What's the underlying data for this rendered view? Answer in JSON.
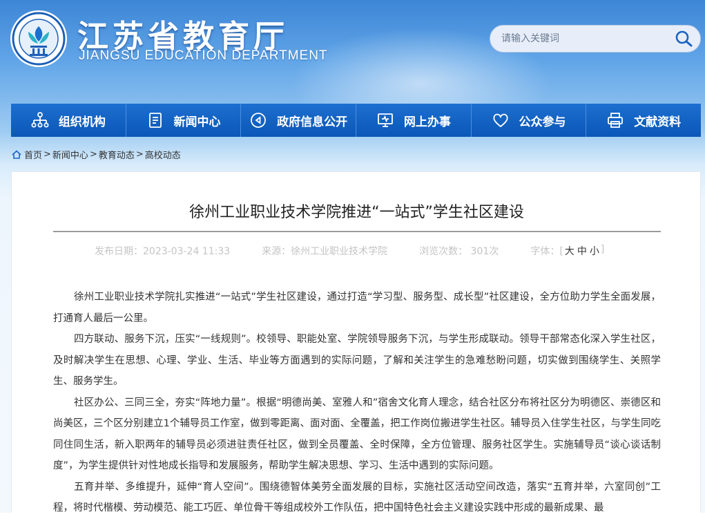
{
  "header": {
    "title_cn": "江苏省教育厅",
    "title_en": "JIANGSU EDUCATION DEPARTMENT",
    "search_placeholder": "请输入关键词",
    "logo_icon": "jiangsu-education-emblem",
    "search_icon": "magnifier"
  },
  "nav": [
    {
      "label": "组织机构",
      "icon": "org-chart-icon"
    },
    {
      "label": "新闻中心",
      "icon": "document-icon"
    },
    {
      "label": "政府信息公开",
      "icon": "play-circle-icon"
    },
    {
      "label": "网上办事",
      "icon": "monitor-icon"
    },
    {
      "label": "公众参与",
      "icon": "heart-icon"
    },
    {
      "label": "文献资料",
      "icon": "printer-icon"
    }
  ],
  "breadcrumb": {
    "items": [
      "首页",
      "新闻中心",
      "教育动态",
      "高校动态"
    ],
    "separator": ">"
  },
  "article": {
    "title": "徐州工业职业技术学院推进“一站式”学生社区建设",
    "date": "发布日期：2023-03-24 11:33",
    "source": "来源：徐州工业职业技术学院",
    "views": "浏览次数： 301次",
    "font_label": "字体：[",
    "font_large": "大",
    "font_medium": "中",
    "font_small": "小",
    "font_close": "]",
    "paragraphs": [
      "徐州工业职业技术学院扎实推进“一站式”学生社区建设，通过打造“学习型、服务型、成长型”社区建设，全方位助力学生全面发展，打通育人最后一公里。",
      "四方联动、服务下沉，压实“一线规则”。校领导、职能处室、学院领导服务下沉，与学生形成联动。领导干部常态化深入学生社区，及时解决学生在思想、心理、学业、生活、毕业等方面遇到的实际问题，了解和关注学生的急难愁盼问题，切实做到围绕学生、关照学生、服务学生。",
      "社区办公、三同三全，夯实“阵地力量”。根据“明德尚美、室雅人和”宿舍文化育人理念，结合社区分布将社区分为明德区、崇德区和尚美区，三个区分别建立1个辅导员工作室，做到零距离、面对面、全覆盖，把工作岗位搬进学生社区。辅导员入住学生社区，与学生同吃同住同生活，新入职两年的辅导员必须进驻责任社区，做到全员覆盖、全时保障，全方位管理、服务社区学生。实施辅导员“谈心谈话制度”，为学生提供针对性地成长指导和发展服务，帮助学生解决思想、学习、生活中遇到的实际问题。",
      "五育并举、多维提升，延伸“育人空间”。围绕德智体美劳全面发展的目标，实施社区活动空间改造，落实“五育并举，六室同创”工程，将时代楷模、劳动模范、能工巧匠、单位骨干等组成校外工作队伍，把中国特色社会主义建设实践中形成的最新成果、最"
    ]
  }
}
